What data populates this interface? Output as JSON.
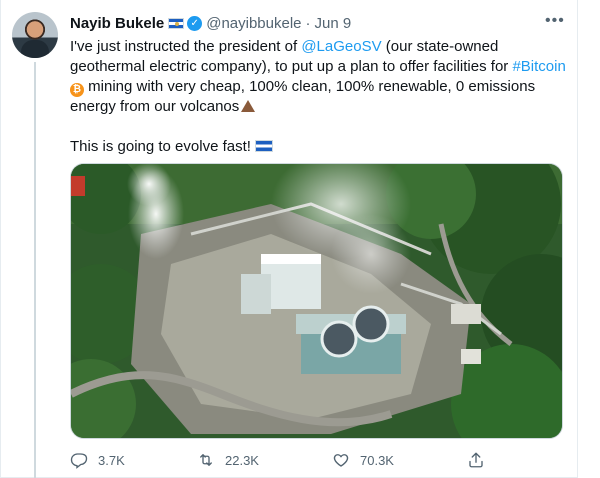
{
  "author": {
    "display_name": "Nayib Bukele",
    "handle": "@nayibbukele",
    "date": "Jun 9"
  },
  "tweet": {
    "t1": "I've just instructed the president of ",
    "mention": "@LaGeoSV",
    "t2": " (our state-owned geothermal electric company), to put up a plan to offer facilities for ",
    "hashtag": "#Bitcoin",
    "t3": " mining with very cheap, 100% clean, 100% renewable, 0 emissions energy from our volcanos",
    "line2": "This is going to evolve fast!"
  },
  "stats": {
    "replies": "3.7K",
    "retweets": "22.3K",
    "likes": "70.3K"
  },
  "icons": {
    "reply": "reply-icon",
    "retweet": "retweet-icon",
    "like": "heart-icon",
    "share": "share-icon",
    "more": "more-icon",
    "verified": "verified-badge-icon"
  },
  "colors": {
    "link": "#1d9bf0",
    "text": "#0f1419",
    "muted": "#536471"
  }
}
